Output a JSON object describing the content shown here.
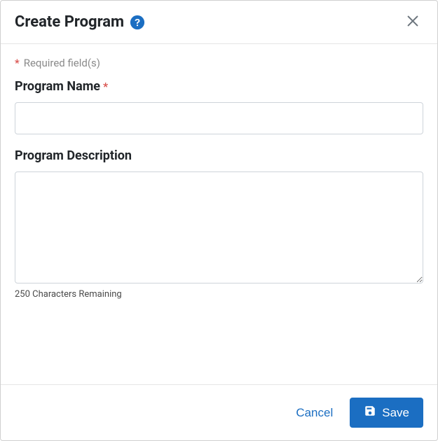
{
  "header": {
    "title": "Create Program"
  },
  "body": {
    "required_note": "Required field(s)",
    "program_name": {
      "label": "Program Name",
      "value": ""
    },
    "program_description": {
      "label": "Program Description",
      "value": "",
      "remaining_text": "250 Characters Remaining"
    }
  },
  "footer": {
    "cancel_label": "Cancel",
    "save_label": "Save"
  }
}
